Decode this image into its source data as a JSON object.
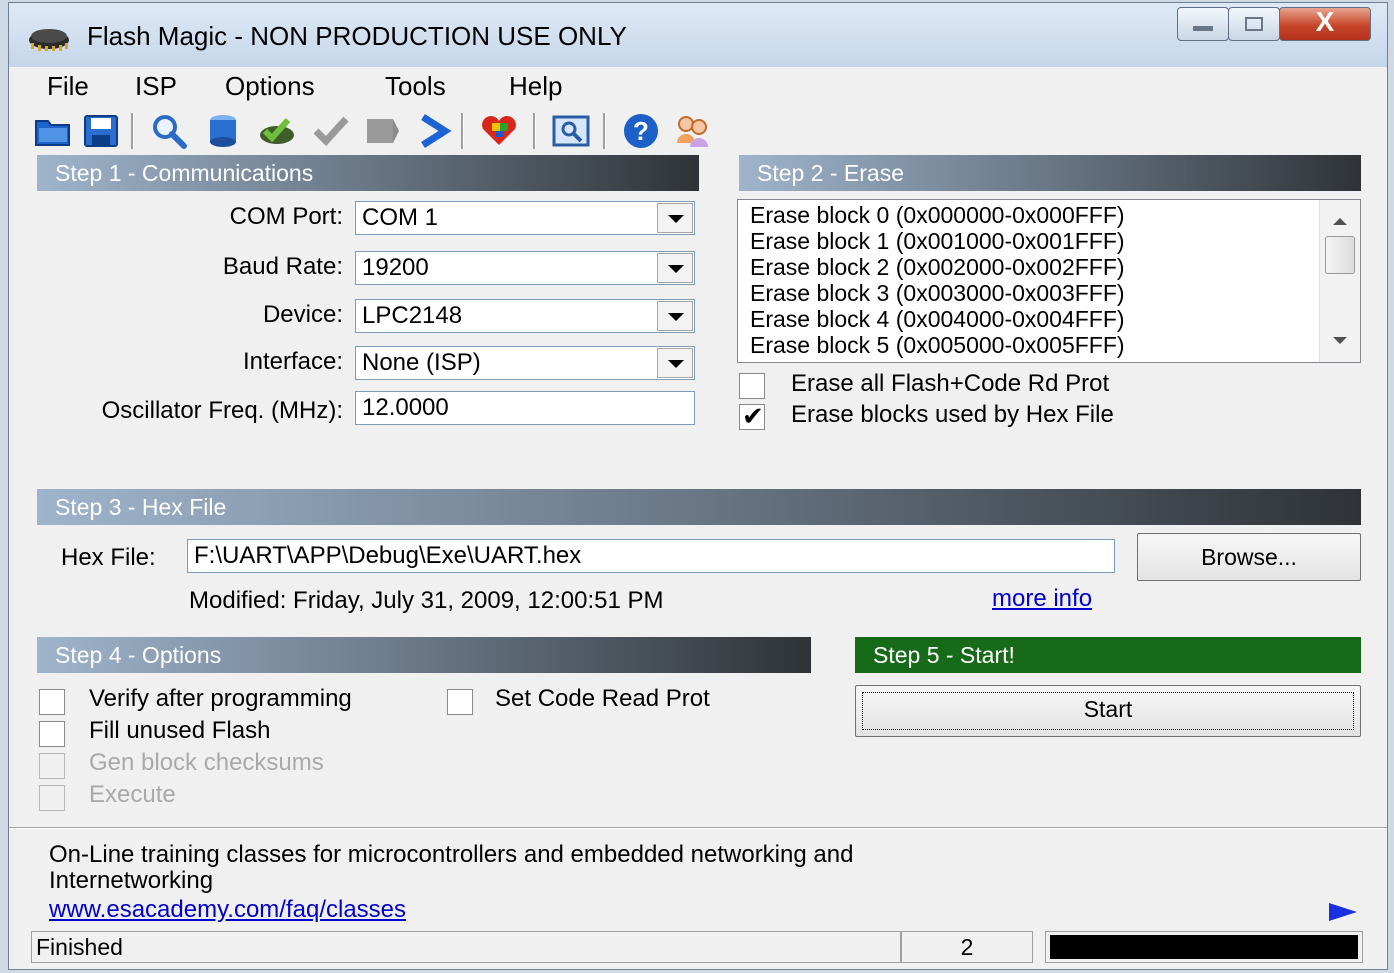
{
  "window": {
    "title": "Flash Magic - NON PRODUCTION USE ONLY",
    "icon": "chip-icon",
    "controls": {
      "minimize": "minimize-icon",
      "maximize": "maximize-icon",
      "close_glyph": "X"
    }
  },
  "menu": {
    "items": [
      "File",
      "ISP",
      "Options",
      "Tools",
      "Help"
    ]
  },
  "toolbar": {
    "icons": [
      "open-folder-icon",
      "save-icon",
      "search-icon",
      "blank-check-icon",
      "program-icon",
      "verify-icon",
      "erase-icon",
      "go-icon",
      "settings-icon",
      "view-icon",
      "help-icon",
      "users-icon"
    ]
  },
  "step1": {
    "header": "Step 1 - Communications",
    "com_port_label": "COM Port:",
    "com_port_value": "COM 1",
    "baud_label": "Baud Rate:",
    "baud_value": "19200",
    "device_label": "Device:",
    "device_value": "LPC2148",
    "interface_label": "Interface:",
    "interface_value": "None (ISP)",
    "osc_label": "Oscillator Freq. (MHz):",
    "osc_value": "12.0000"
  },
  "step2": {
    "header": "Step 2 - Erase",
    "blocks": [
      "Erase block 0 (0x000000-0x000FFF)",
      "Erase block 1 (0x001000-0x001FFF)",
      "Erase block 2 (0x002000-0x002FFF)",
      "Erase block 3 (0x003000-0x003FFF)",
      "Erase block 4 (0x004000-0x004FFF)",
      "Erase block 5 (0x005000-0x005FFF)"
    ],
    "erase_all_label": "Erase all Flash+Code Rd Prot",
    "erase_all_checked": false,
    "erase_used_label": "Erase blocks used by Hex File",
    "erase_used_checked": true
  },
  "step3": {
    "header": "Step 3 - Hex File",
    "hex_label": "Hex File:",
    "hex_value": "F:\\UART\\APP\\Debug\\Exe\\UART.hex",
    "browse_label": "Browse...",
    "modified_text": "Modified: Friday, July 31, 2009, 12:00:51 PM",
    "more_info": "more info"
  },
  "step4": {
    "header": "Step 4 - Options",
    "verify_label": "Verify after programming",
    "set_crp_label": "Set Code Read Prot",
    "fill_label": "Fill unused Flash",
    "gen_label": "Gen block checksums",
    "execute_label": "Execute"
  },
  "step5": {
    "header": "Step 5 - Start!",
    "start_label": "Start"
  },
  "footer": {
    "ad_text_line1": "On-Line training classes for microcontrollers and embedded networking and",
    "ad_text_line2": "Internetworking",
    "ad_link": "www.esacademy.com/faq/classes",
    "next_icon": "play-arrow-icon"
  },
  "status": {
    "text": "Finished",
    "count": "2",
    "progress": 0
  },
  "colors": {
    "accent_green": "#176a18",
    "link_blue": "#0000cc",
    "progress_black": "#000000"
  }
}
